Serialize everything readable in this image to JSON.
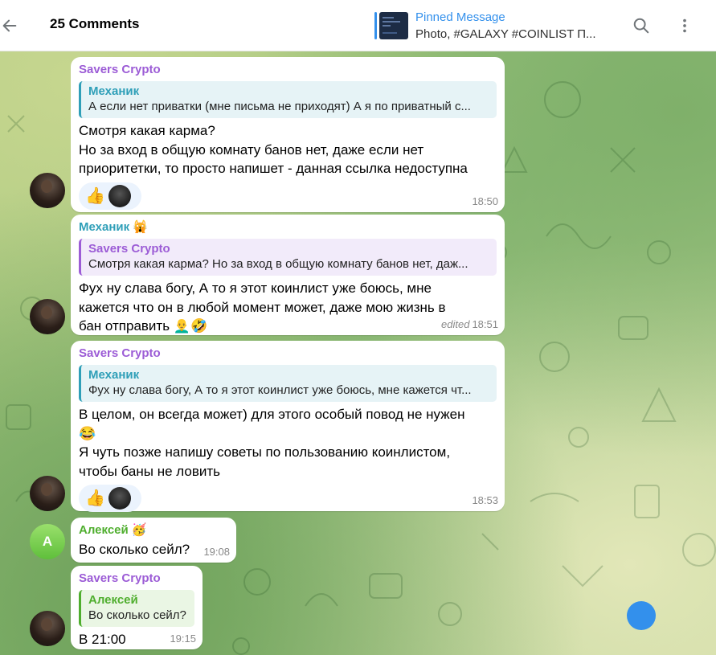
{
  "header": {
    "title": "25 Comments",
    "pinned_title": "Pinned Message",
    "pinned_text": "Photo, #GALAXY #COINLIST П..."
  },
  "colors": {
    "accent": "#3390ec",
    "savers": "#9c5cd6",
    "mechanic": "#2f9fb8",
    "aleksey": "#4fae2e"
  },
  "messages": [
    {
      "sender": "Savers Crypto",
      "reply_name": "Механик",
      "reply_text": "А если нет приватки (мне письма не приходят) А я по приватный с...",
      "lines": [
        "Смотря какая карма?",
        "Но за вход в общую комнату банов нет, даже если нет",
        "приоритетки, то просто напишет - данная ссылка недоступна"
      ],
      "reactions": [
        "👍"
      ],
      "time": "18:50"
    },
    {
      "sender": "Механик",
      "sender_emoji": "🙀",
      "reply_name": "Savers Crypto",
      "reply_text": "Смотря какая карма? Но за вход в общую комнату банов нет, даж...",
      "lines": [
        "Фух ну слава богу, А то я этот коинлист уже боюсь, мне",
        "кажется что он в любой момент может, даже мою жизнь в",
        "бан отправить 👨‍🦲🤣"
      ],
      "edited": "edited",
      "time": "18:51"
    },
    {
      "sender": "Savers Crypto",
      "reply_name": "Механик",
      "reply_text": "Фух ну слава богу, А то я этот коинлист уже боюсь, мне кажется чт...",
      "lines": [
        "В целом, он всегда может) для этого особый повод не нужен",
        "😂",
        "Я чуть позже напишу советы по пользованию коинлистом,",
        "чтобы баны не ловить"
      ],
      "reactions": [
        "👍"
      ],
      "time": "18:53"
    },
    {
      "sender": "Алексей",
      "sender_emoji": "🥳",
      "avatar_letter": "A",
      "lines": [
        "Во сколько сейл?"
      ],
      "time": "19:08"
    },
    {
      "sender": "Savers Crypto",
      "reply_name": "Алексей",
      "reply_text": "Во сколько сейл?",
      "lines": [
        "В 21:00"
      ],
      "time": "19:15"
    }
  ]
}
